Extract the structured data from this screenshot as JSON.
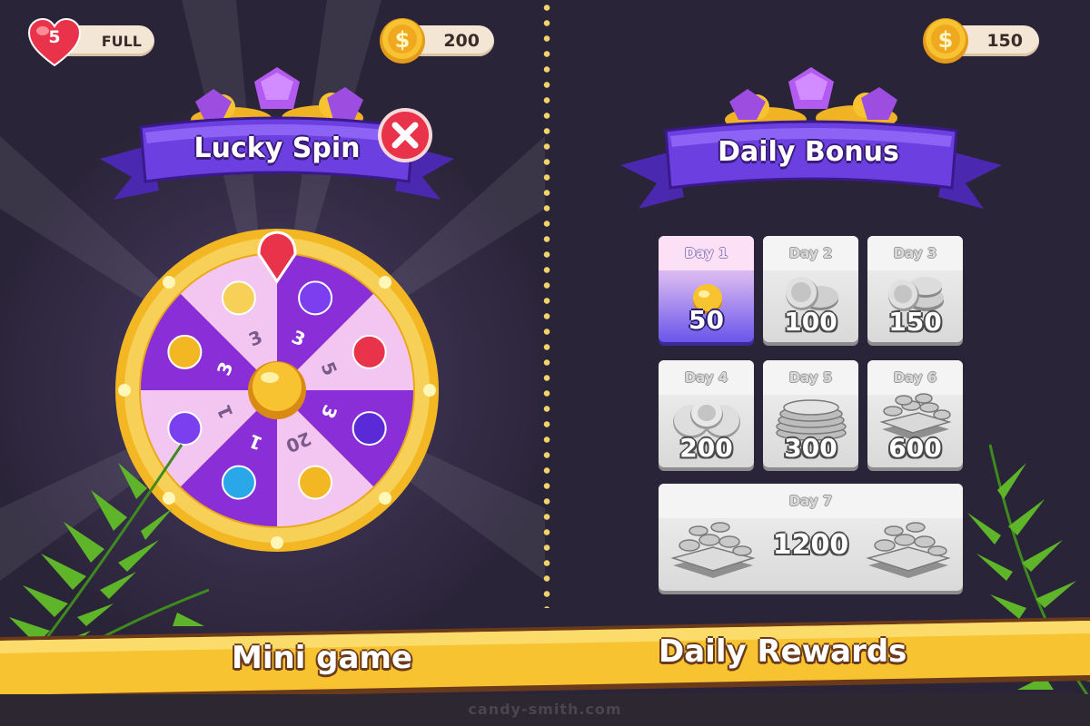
{
  "status_bar": {
    "lives_count": "5",
    "lives_status": "FULL",
    "coins_left": "200",
    "coins_right": "150"
  },
  "lucky_spin": {
    "title": "Lucky Spin",
    "segments": [
      "3",
      "5",
      "3",
      "20",
      "1",
      "1",
      "3",
      "3"
    ]
  },
  "daily_bonus": {
    "title": "Daily Bonus",
    "days": [
      {
        "label": "Day 1",
        "amount": "50"
      },
      {
        "label": "Day 2",
        "amount": "100"
      },
      {
        "label": "Day 3",
        "amount": "150"
      },
      {
        "label": "Day 4",
        "amount": "200"
      },
      {
        "label": "Day 5",
        "amount": "300"
      },
      {
        "label": "Day 6",
        "amount": "600"
      },
      {
        "label": "Day 7",
        "amount": "1200"
      }
    ]
  },
  "footer": {
    "left_caption": "Mini game",
    "right_caption": "Daily Rewards",
    "credit": "candy-smith.com"
  },
  "icons": [
    "heart-icon",
    "coin-icon",
    "close-icon",
    "gem-icon",
    "paint-roller-icon",
    "magnet-icon",
    "candy-heart-icon",
    "striped-candy-icon",
    "coin-stack-icon",
    "plunger-icon",
    "bomb-icon",
    "jam-jar-icon",
    "silver-coin-icon",
    "silver-bar-icon",
    "palm-leaf-icon"
  ],
  "colors": {
    "background": "#2a2438",
    "banner_purple": "#6b3fe0",
    "accent_gold": "#f3c23a",
    "active_card": "#6a55ea",
    "close_red": "#e8334a"
  }
}
